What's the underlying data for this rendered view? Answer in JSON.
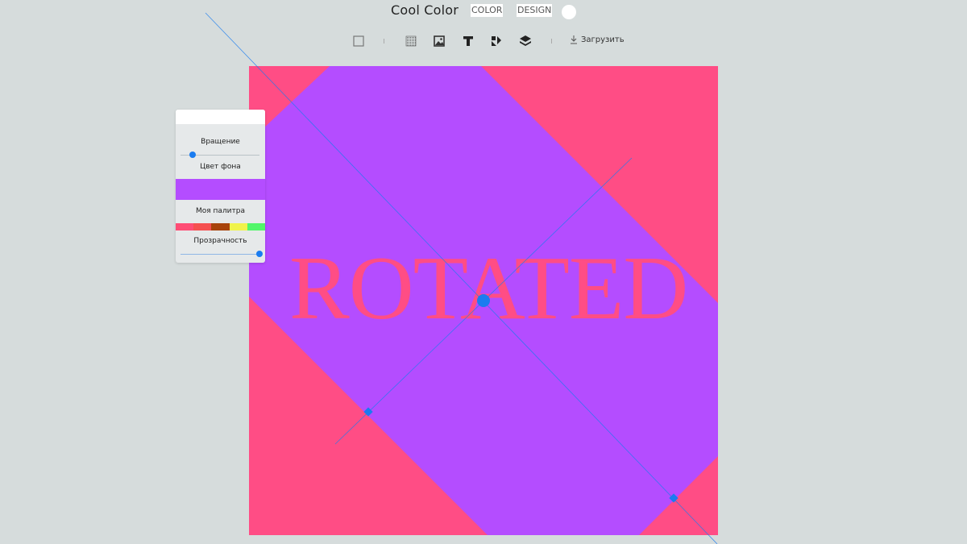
{
  "header": {
    "title": "Cool Color",
    "nav": {
      "color": "COLOR",
      "design": "DESIGN"
    }
  },
  "toolbar": {
    "tools": [
      "checkbox-icon",
      "texture-icon",
      "image-icon",
      "text-icon",
      "shape-icon",
      "layers-icon"
    ],
    "download_label": "Загрузить"
  },
  "canvas": {
    "text": "ROTATED",
    "colors": {
      "background": "#ff4d85",
      "band": "#b44dff",
      "text": "#ff4d85",
      "guide": "#1a7cf0"
    }
  },
  "panel": {
    "rotation_label": "Вращение",
    "rotation_value": 0.15,
    "bg_color_label": "Цвет фона",
    "bg_color": "#b44dff",
    "palette_label": "Моя палитра",
    "palette": [
      "#ff4d75",
      "#f55050",
      "#a8430b",
      "#f0f34a",
      "#52f66a"
    ],
    "opacity_label": "Прозрачность",
    "opacity_value": 1.0
  }
}
